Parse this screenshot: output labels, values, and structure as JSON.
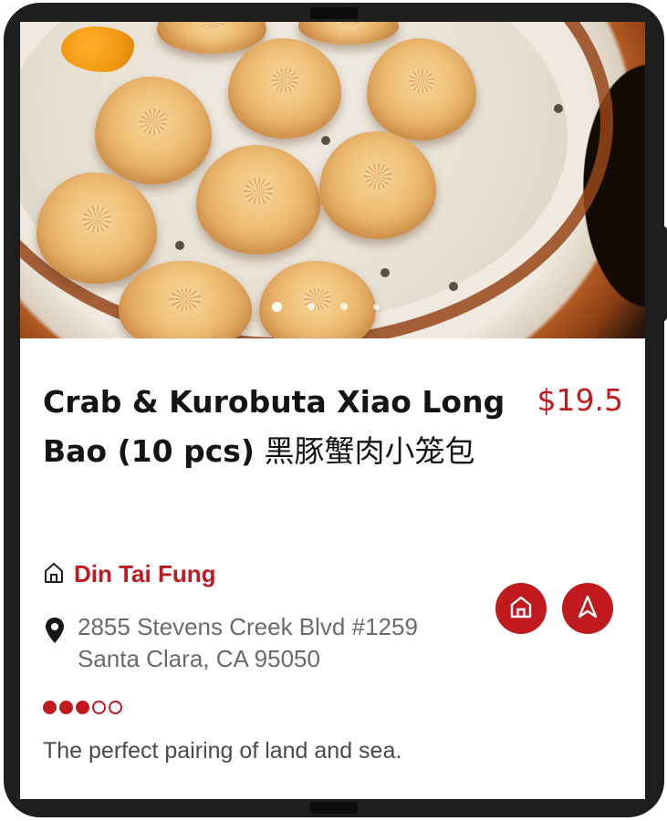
{
  "carousel": {
    "image_alt": "Crab & Kurobuta Xiao Long Bao in a bamboo steamer",
    "page_count": 4,
    "active_index": 0
  },
  "item": {
    "title_en": "Crab & Kurobuta Xiao Long Bao (10 pcs)",
    "title_cn_first": "黑豚蟹",
    "title_cn_second": "肉小笼包",
    "price": "$19.5",
    "description": "The perfect pairing of land and sea."
  },
  "restaurant": {
    "name": "Din Tai Fung",
    "icon": "home-outline-icon",
    "address_line1": "2855 Stevens Creek Blvd #1259",
    "address_line2": "Santa Clara, CA 95050",
    "address_icon": "map-pin-icon"
  },
  "rating": {
    "value": 3,
    "max": 5
  },
  "actions": {
    "home_button_icon": "home-icon",
    "navigate_button_icon": "navigation-arrow-icon"
  },
  "colors": {
    "accent": "#c0191e",
    "frame": "#1e1e1e",
    "text_primary": "#141414",
    "text_secondary": "#6a6a6a"
  }
}
